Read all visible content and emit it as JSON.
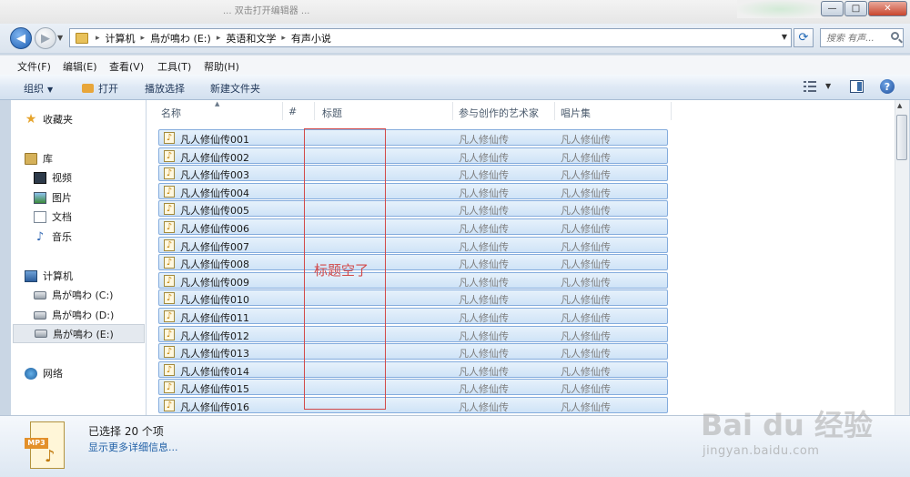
{
  "title_bar": {
    "blurred_text": "... 双击打开编辑器 ..."
  },
  "window_buttons": {
    "minimize": "—",
    "maximize": "□",
    "close": "✕"
  },
  "address": {
    "breadcrumbs": [
      "计算机",
      "鳥が鳴わ (E:)",
      "英语和文学",
      "有声小说"
    ],
    "search_placeholder": "搜索 有声..."
  },
  "menu": [
    "文件(F)",
    "编辑(E)",
    "查看(V)",
    "工具(T)",
    "帮助(H)"
  ],
  "toolbar": {
    "organize": "组织",
    "open": "打开",
    "play_selection": "播放选择",
    "new_folder": "新建文件夹"
  },
  "nav": {
    "favorites": "收藏夹",
    "libraries": "库",
    "videos": "视频",
    "pictures": "图片",
    "documents": "文档",
    "music": "音乐",
    "computer": "计算机",
    "drive_c": "鳥が鳴わ (C:)",
    "drive_d": "鳥が鳴わ (D:)",
    "drive_e": "鳥が鳴わ (E:)",
    "network": "网络"
  },
  "columns": {
    "name": "名称",
    "number": "#",
    "title": "标题",
    "artists": "参与创作的艺术家",
    "album": "唱片集"
  },
  "files": [
    {
      "name": "凡人修仙传001",
      "artist": "凡人修仙传",
      "album": "凡人修仙传"
    },
    {
      "name": "凡人修仙传002",
      "artist": "凡人修仙传",
      "album": "凡人修仙传"
    },
    {
      "name": "凡人修仙传003",
      "artist": "凡人修仙传",
      "album": "凡人修仙传"
    },
    {
      "name": "凡人修仙传004",
      "artist": "凡人修仙传",
      "album": "凡人修仙传"
    },
    {
      "name": "凡人修仙传005",
      "artist": "凡人修仙传",
      "album": "凡人修仙传"
    },
    {
      "name": "凡人修仙传006",
      "artist": "凡人修仙传",
      "album": "凡人修仙传"
    },
    {
      "name": "凡人修仙传007",
      "artist": "凡人修仙传",
      "album": "凡人修仙传"
    },
    {
      "name": "凡人修仙传008",
      "artist": "凡人修仙传",
      "album": "凡人修仙传"
    },
    {
      "name": "凡人修仙传009",
      "artist": "凡人修仙传",
      "album": "凡人修仙传"
    },
    {
      "name": "凡人修仙传010",
      "artist": "凡人修仙传",
      "album": "凡人修仙传"
    },
    {
      "name": "凡人修仙传011",
      "artist": "凡人修仙传",
      "album": "凡人修仙传"
    },
    {
      "name": "凡人修仙传012",
      "artist": "凡人修仙传",
      "album": "凡人修仙传"
    },
    {
      "name": "凡人修仙传013",
      "artist": "凡人修仙传",
      "album": "凡人修仙传"
    },
    {
      "name": "凡人修仙传014",
      "artist": "凡人修仙传",
      "album": "凡人修仙传"
    },
    {
      "name": "凡人修仙传015",
      "artist": "凡人修仙传",
      "album": "凡人修仙传"
    },
    {
      "name": "凡人修仙传016",
      "artist": "凡人修仙传",
      "album": "凡人修仙传"
    }
  ],
  "annotation": {
    "label": "标题空了",
    "color": "#d24a4a"
  },
  "details": {
    "thumb_label": "MP3",
    "selected_count": "已选择 20 个项",
    "more_details": "显示更多详细信息..."
  },
  "watermark": {
    "main": "Bai du 经验",
    "sub": "jingyan.baidu.com"
  },
  "colors": {
    "row_selected": "#cfe3f7",
    "row_border": "#84acdd",
    "link": "#1f5fa6"
  }
}
